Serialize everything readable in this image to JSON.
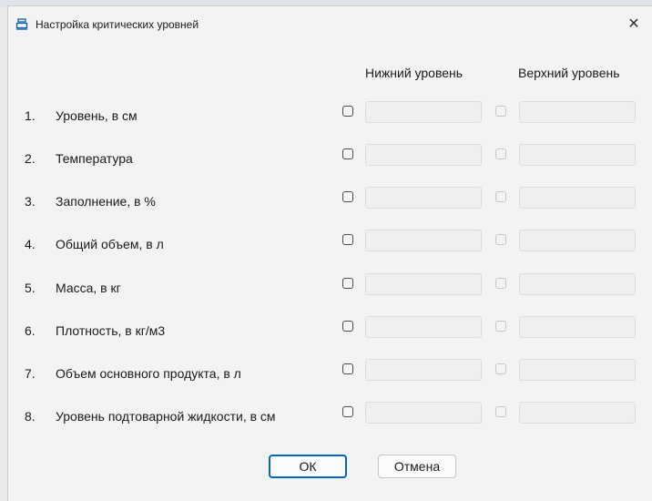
{
  "window": {
    "title": "Настройка критических уровней",
    "close_glyph": "✕"
  },
  "headers": {
    "lower": "Нижний уровень",
    "upper": "Верхний уровень"
  },
  "rows": [
    {
      "num": "1.",
      "label": "Уровень, в см"
    },
    {
      "num": "2.",
      "label": "Температура"
    },
    {
      "num": "3.",
      "label": "Заполнение, в %"
    },
    {
      "num": "4.",
      "label": "Общий объем, в л"
    },
    {
      "num": "5.",
      "label": "Масса, в кг"
    },
    {
      "num": "6.",
      "label": "Плотность, в кг/м3"
    },
    {
      "num": "7.",
      "label": "Объем основного продукта, в л"
    },
    {
      "num": "8.",
      "label": "Уровень подтоварной жидкости, в см"
    }
  ],
  "buttons": {
    "ok": "ОК",
    "cancel": "Отмена"
  },
  "colors": {
    "accent": "#0067c0",
    "dialog_bg": "#f3f3f3"
  },
  "icons": {
    "title": "tank-icon",
    "close": "close-icon"
  }
}
